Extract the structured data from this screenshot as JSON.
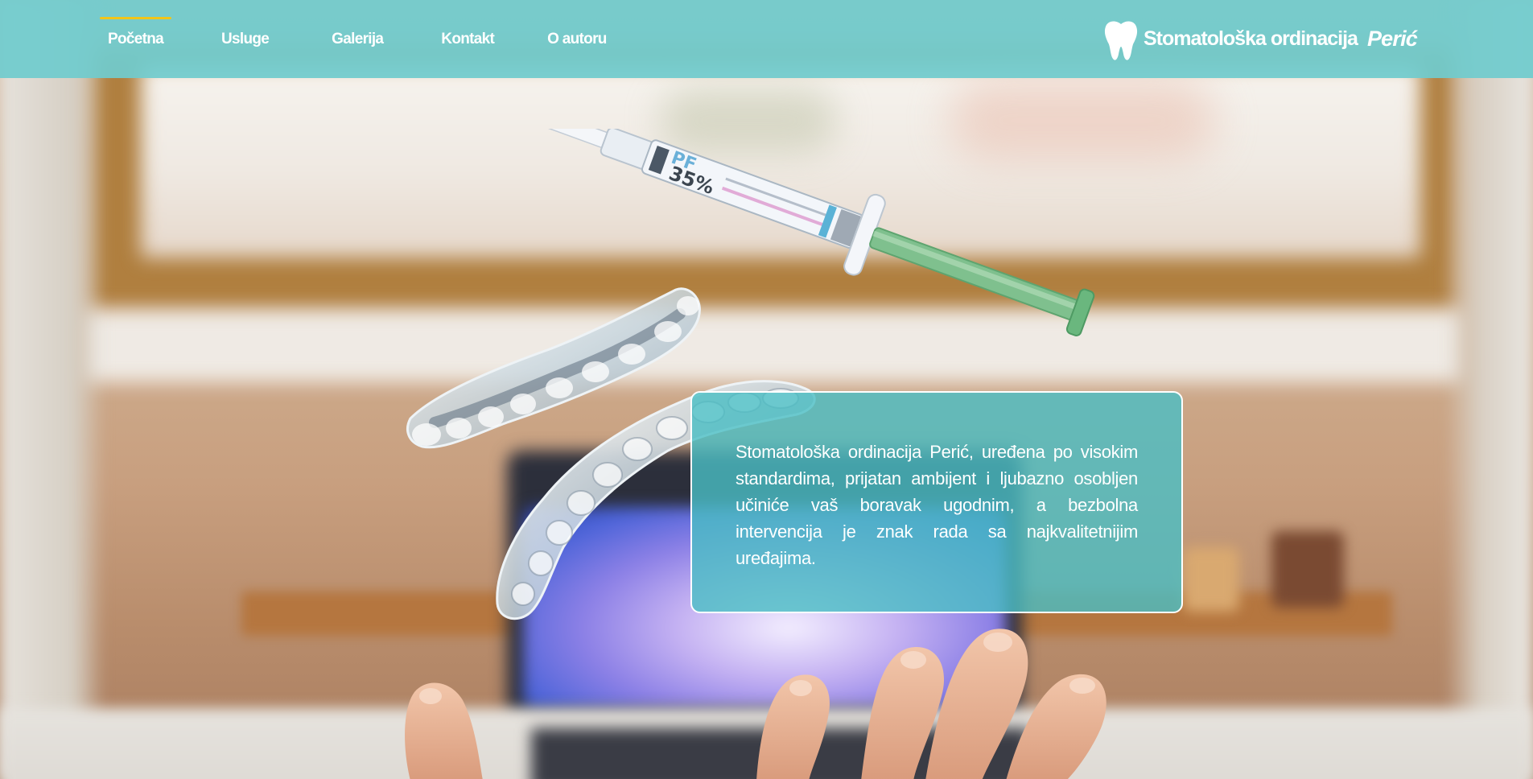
{
  "nav": {
    "items": [
      {
        "label": "Početna",
        "active": true
      },
      {
        "label": "Usluge",
        "active": false
      },
      {
        "label": "Galerija",
        "active": false
      },
      {
        "label": "Kontakt",
        "active": false
      },
      {
        "label": "O autoru",
        "active": false
      }
    ],
    "active_indicator_color": "#f2c518",
    "background_color": "#70cbce"
  },
  "brand": {
    "logo_icon": "tooth-icon",
    "name": "Stomatološka ordinacija",
    "surname": "Perić"
  },
  "hero": {
    "background": "blurred-office-photo",
    "syringe_label": "35%",
    "syringe_brand_fragment": "PF",
    "info_text": "Stomatološka ordinacija Perić, uređena po visokim standardima, prijatan ambijent i ljubazno osobljen učiniće vaš boravak ugodnim, a bezbolna intervencija je znak rada sa najkvalitetnijim uređajima."
  },
  "colors": {
    "accent": "#f2c518",
    "teal": "#4abec4",
    "text": "#ffffff"
  }
}
